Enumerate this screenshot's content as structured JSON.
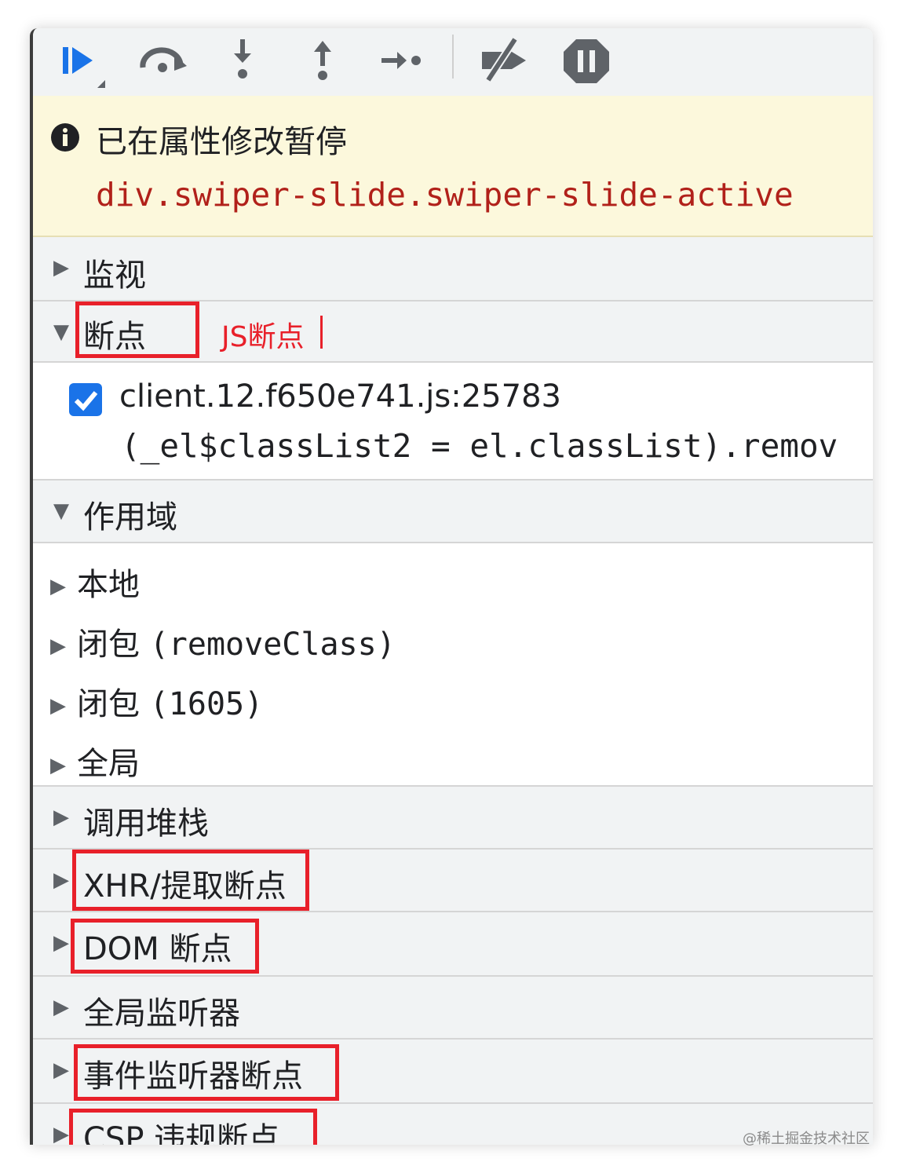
{
  "toolbar": {
    "buttons": [
      "resume-icon",
      "step-over-icon",
      "step-into-icon",
      "step-out-icon",
      "step-icon",
      "deactivate-breakpoints-icon",
      "pause-on-exceptions-icon"
    ]
  },
  "banner": {
    "title": "已在属性修改暂停",
    "code": "div.swiper-slide.swiper-slide-active"
  },
  "sections": {
    "watch": "监视",
    "breakpoints": "断点",
    "breakpoints_annotation": "JS断点",
    "scope": "作用域",
    "call_stack": "调用堆栈",
    "xhr": "XHR/提取断点",
    "dom": "DOM 断点",
    "global_listeners": "全局监听器",
    "event_listener": "事件监听器断点",
    "csp": "CSP 违规断点"
  },
  "breakpoint_item": {
    "file": "client.12.f650e741.js:25783",
    "code": "(_el$classList2 = el.classList).remov"
  },
  "scope_items": {
    "local": "本地",
    "closure1_prefix": "闭包",
    "closure1_name": "(removeClass)",
    "closure2_prefix": "闭包",
    "closure2_name": "(1605)",
    "global": "全局"
  },
  "watermark": "@稀土掘金技术社区",
  "colors": {
    "highlight_box": "#e8202a",
    "accent": "#1a73e8",
    "banner_bg": "#fcf8dc",
    "code_red": "#b1211a"
  }
}
